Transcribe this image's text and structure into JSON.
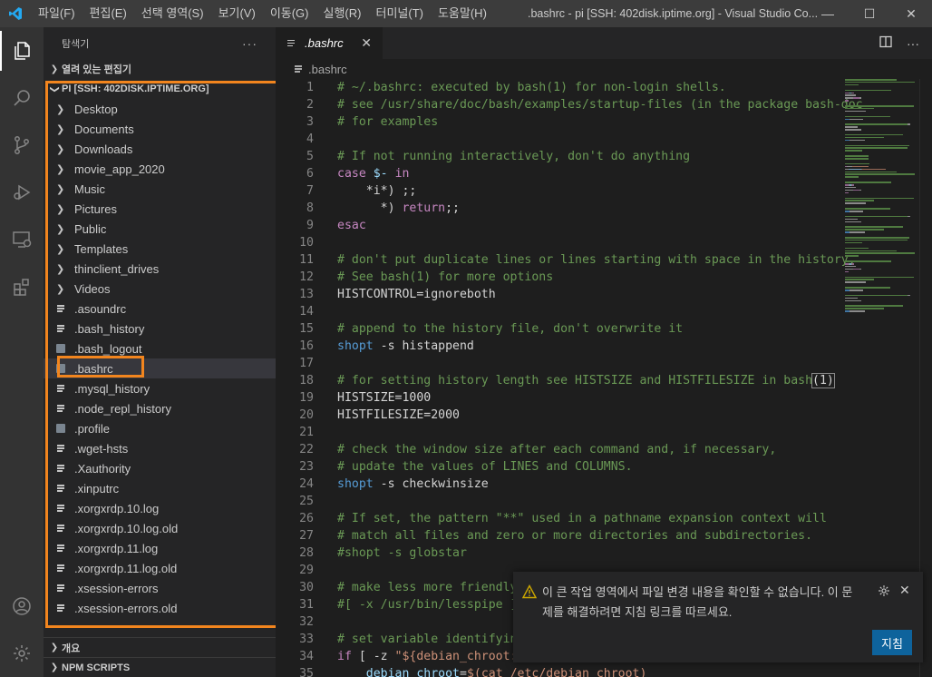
{
  "titlebar": {
    "menu": [
      "파일(F)",
      "편집(E)",
      "선택 영역(S)",
      "보기(V)",
      "이동(G)",
      "실행(R)",
      "터미널(T)",
      "도움말(H)"
    ],
    "window_title": ".bashrc - pi [SSH: 402disk.iptime.org] - Visual Studio Co...",
    "minimize": "—",
    "restore": "☐",
    "close": "✕"
  },
  "sidebar": {
    "header": "탐색기",
    "more": "···",
    "open_editors": "열려 있는 편집기",
    "root": "PI [SSH: 402DISK.IPTIME.ORG]",
    "folders": [
      "Desktop",
      "Documents",
      "Downloads",
      "movie_app_2020",
      "Music",
      "Pictures",
      "Public",
      "Templates",
      "thinclient_drives",
      "Videos"
    ],
    "files": [
      {
        "name": ".asoundrc",
        "icon": "lines"
      },
      {
        "name": ".bash_history",
        "icon": "lines"
      },
      {
        "name": ".bash_logout",
        "icon": "gear"
      },
      {
        "name": ".bashrc",
        "icon": "gear",
        "selected": true
      },
      {
        "name": ".mysql_history",
        "icon": "lines"
      },
      {
        "name": ".node_repl_history",
        "icon": "lines"
      },
      {
        "name": ".profile",
        "icon": "gear"
      },
      {
        "name": ".wget-hsts",
        "icon": "lines"
      },
      {
        "name": ".Xauthority",
        "icon": "lines"
      },
      {
        "name": ".xinputrc",
        "icon": "lines"
      },
      {
        "name": ".xorgxrdp.10.log",
        "icon": "lines"
      },
      {
        "name": ".xorgxrdp.10.log.old",
        "icon": "lines"
      },
      {
        "name": ".xorgxrdp.11.log",
        "icon": "lines"
      },
      {
        "name": ".xorgxrdp.11.log.old",
        "icon": "lines"
      },
      {
        "name": ".xsession-errors",
        "icon": "lines"
      },
      {
        "name": ".xsession-errors.old",
        "icon": "lines"
      }
    ],
    "outline": "개요",
    "npm_scripts": "NPM SCRIPTS"
  },
  "editor": {
    "tab_label": ".bashrc",
    "tab_close": "✕",
    "breadcrumb": ".bashrc",
    "lines": [
      [
        [
          "c",
          "# ~/.bashrc: executed by bash(1) for non-login shells."
        ]
      ],
      [
        [
          "c",
          "# see /usr/share/doc/bash/examples/startup-files (in the package bash-doc"
        ]
      ],
      [
        [
          "c",
          "# for examples"
        ]
      ],
      [],
      [
        [
          "c",
          "# If not running interactively, don't do anything"
        ]
      ],
      [
        [
          "x",
          "case"
        ],
        [
          "p",
          " "
        ],
        [
          "v",
          "$-"
        ],
        [
          "p",
          " "
        ],
        [
          "x",
          "in"
        ]
      ],
      [
        [
          "p",
          "    *i*) ;;"
        ]
      ],
      [
        [
          "p",
          "      *) "
        ],
        [
          "x",
          "return"
        ],
        [
          "p",
          ";;"
        ]
      ],
      [
        [
          "x",
          "esac"
        ]
      ],
      [],
      [
        [
          "c",
          "# don't put duplicate lines or lines starting with space in the history."
        ]
      ],
      [
        [
          "c",
          "# See bash(1) for more options"
        ]
      ],
      [
        [
          "p",
          "HISTCONTROL=ignoreboth"
        ]
      ],
      [],
      [
        [
          "c",
          "# append to the history file, don't overwrite it"
        ]
      ],
      [
        [
          "k",
          "shopt"
        ],
        [
          "p",
          " -s histappend"
        ]
      ],
      [],
      [
        [
          "c",
          "# for setting history length see HISTSIZE and HISTFILESIZE in bash"
        ],
        [
          "b",
          "(1)"
        ]
      ],
      [
        [
          "p",
          "HISTSIZE=1000"
        ]
      ],
      [
        [
          "p",
          "HISTFILESIZE=2000"
        ]
      ],
      [],
      [
        [
          "c",
          "# check the window size after each command and, if necessary,"
        ]
      ],
      [
        [
          "c",
          "# update the values of LINES and COLUMNS."
        ]
      ],
      [
        [
          "k",
          "shopt"
        ],
        [
          "p",
          " -s checkwinsize"
        ]
      ],
      [],
      [
        [
          "c",
          "# If set, the pattern \"**\" used in a pathname expansion context will"
        ]
      ],
      [
        [
          "c",
          "# match all files and zero or more directories and subdirectories."
        ]
      ],
      [
        [
          "c",
          "#shopt -s globstar"
        ]
      ],
      [],
      [
        [
          "c",
          "# make less more friendly"
        ]
      ],
      [
        [
          "c",
          "#[ -x /usr/bin/lesspipe ]"
        ]
      ],
      [],
      [
        [
          "c",
          "# set variable identifying"
        ]
      ],
      [
        [
          "x",
          "if"
        ],
        [
          "p",
          " [ -z "
        ],
        [
          "s",
          "\"${debian_chroot:"
        ]
      ],
      [
        [
          "p",
          "    "
        ],
        [
          "v",
          "debian_chroot"
        ],
        [
          "p",
          "="
        ],
        [
          "s",
          "$(cat /etc/debian_chroot)"
        ]
      ]
    ]
  },
  "notification": {
    "message": "이 큰 작업 영역에서 파일 변경 내용을 확인할 수 없습니다. 이 문제를 해결하려면 지침 링크를 따르세요.",
    "button": "지침",
    "close": "✕"
  },
  "colors": {
    "accent": "#0e639c",
    "annotation": "#f2851e",
    "warning": "#cca700"
  }
}
